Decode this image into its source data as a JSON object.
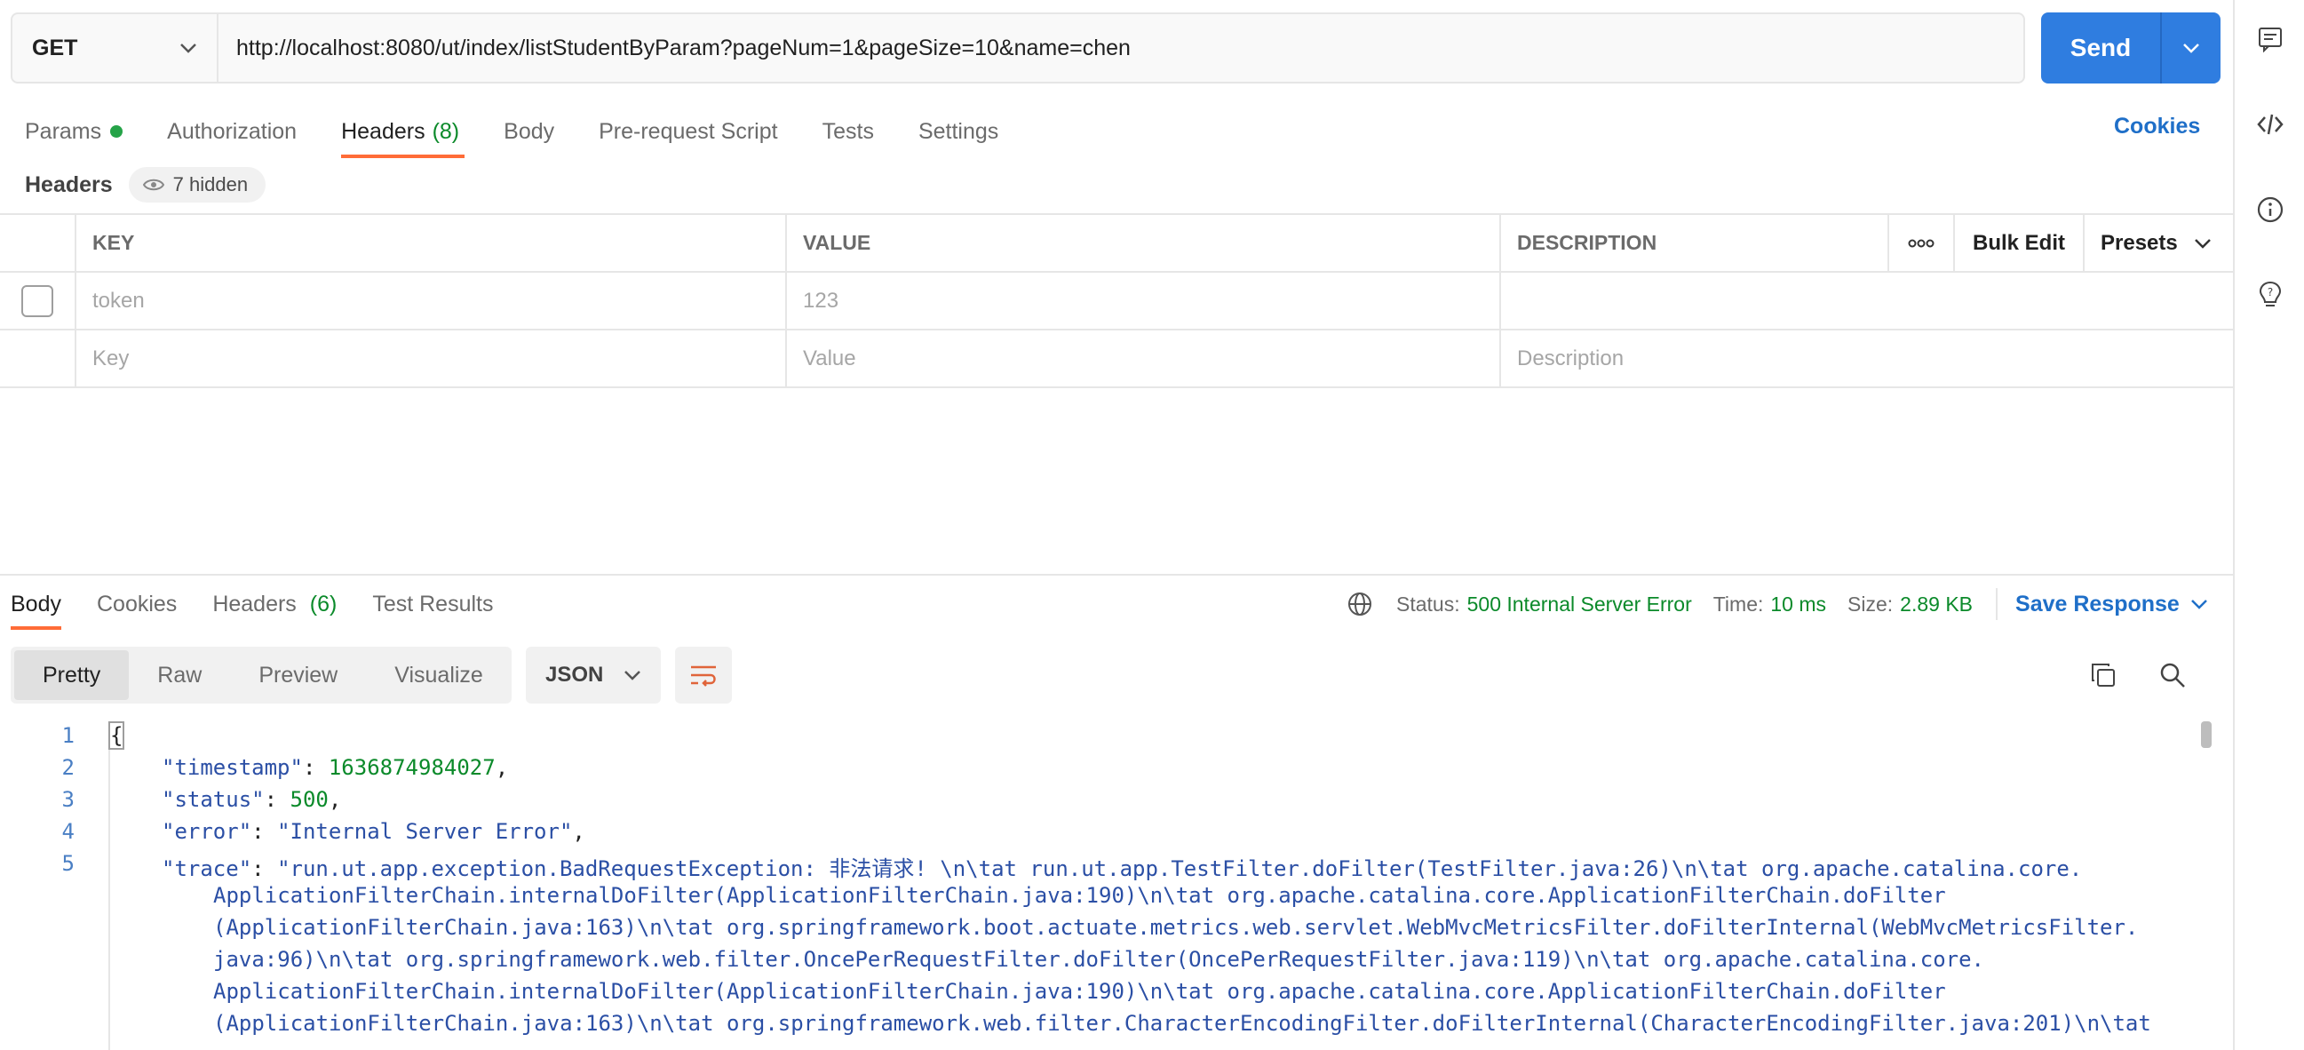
{
  "request": {
    "method": "GET",
    "url": "http://localhost:8080/ut/index/listStudentByParam?pageNum=1&pageSize=10&name=chen",
    "send_label": "Send"
  },
  "request_tabs": [
    {
      "label": "Params"
    },
    {
      "label": "Authorization"
    },
    {
      "label": "Headers",
      "count": "(8)"
    },
    {
      "label": "Body"
    },
    {
      "label": "Pre-request Script"
    },
    {
      "label": "Tests"
    },
    {
      "label": "Settings"
    }
  ],
  "cookies_link": "Cookies",
  "headers_section": {
    "title": "Headers",
    "hidden_label": "7 hidden"
  },
  "headers_table": {
    "columns": [
      "KEY",
      "VALUE",
      "DESCRIPTION"
    ],
    "bulk_edit": "Bulk Edit",
    "presets": "Presets",
    "rows": [
      {
        "key": "token",
        "value": "123",
        "description": ""
      }
    ],
    "placeholders": {
      "key": "Key",
      "value": "Value",
      "description": "Description"
    }
  },
  "response_tabs": [
    {
      "label": "Body"
    },
    {
      "label": "Cookies"
    },
    {
      "label": "Headers",
      "count": "(6)"
    },
    {
      "label": "Test Results"
    }
  ],
  "response_status": {
    "status_label": "Status:",
    "status_value": "500 Internal Server Error",
    "time_label": "Time:",
    "time_value": "10 ms",
    "size_label": "Size:",
    "size_value": "2.89 KB",
    "save_response": "Save Response"
  },
  "view_modes": [
    "Pretty",
    "Raw",
    "Preview",
    "Visualize"
  ],
  "format": "JSON",
  "code": {
    "line_numbers": [
      "1",
      "2",
      "3",
      "4",
      "5"
    ],
    "open_brace": "{",
    "timestamp_key": "\"timestamp\"",
    "timestamp_value": "1636874984027",
    "status_key": "\"status\"",
    "status_value": "500",
    "error_key": "\"error\"",
    "error_value": "\"Internal Server Error\"",
    "trace_key": "\"trace\"",
    "trace_lines": [
      "\"run.ut.app.exception.BadRequestException: 非法请求! \\n\\tat run.ut.app.TestFilter.doFilter(TestFilter.java:26)\\n\\tat org.apache.catalina.core.",
      "ApplicationFilterChain.internalDoFilter(ApplicationFilterChain.java:190)\\n\\tat org.apache.catalina.core.ApplicationFilterChain.doFilter",
      "(ApplicationFilterChain.java:163)\\n\\tat org.springframework.boot.actuate.metrics.web.servlet.WebMvcMetricsFilter.doFilterInternal(WebMvcMetricsFilter.",
      "java:96)\\n\\tat org.springframework.web.filter.OncePerRequestFilter.doFilter(OncePerRequestFilter.java:119)\\n\\tat org.apache.catalina.core.",
      "ApplicationFilterChain.internalDoFilter(ApplicationFilterChain.java:190)\\n\\tat org.apache.catalina.core.ApplicationFilterChain.doFilter",
      "(ApplicationFilterChain.java:163)\\n\\tat org.springframework.web.filter.CharacterEncodingFilter.doFilterInternal(CharacterEncodingFilter.java:201)\\n\\tat"
    ]
  },
  "colors": {
    "accent": "#ff6c37",
    "send": "#2f7de0",
    "link": "#1f6fc8",
    "success_text": "#0b8a2a"
  }
}
